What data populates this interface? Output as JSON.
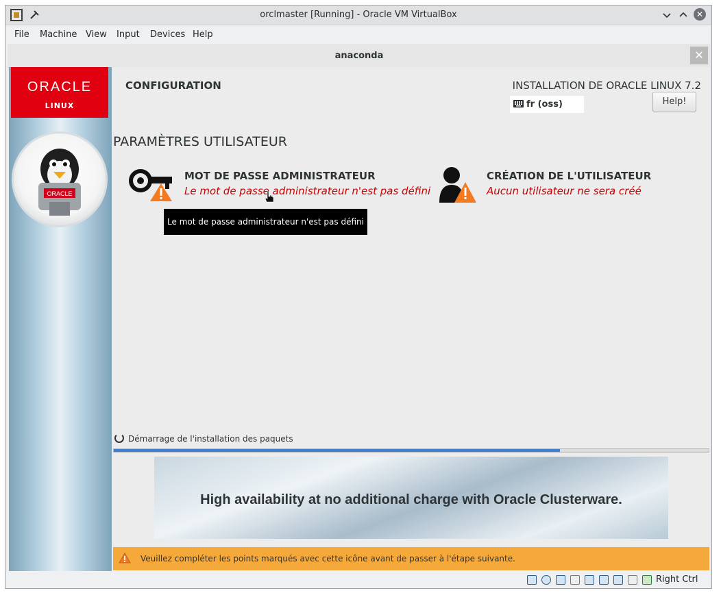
{
  "window": {
    "title": "orclmaster [Running] - Oracle VM VirtualBox"
  },
  "menu": [
    "File",
    "Machine",
    "View",
    "Input",
    "Devices",
    "Help"
  ],
  "anaconda": {
    "title": "anaconda",
    "close_label": "✕"
  },
  "sidebar": {
    "logo_line1": "ORACLE",
    "logo_line2": "LINUX",
    "mascot_badge": "ORACLE"
  },
  "header": {
    "section": "CONFIGURATION",
    "product": "INSTALLATION DE ORACLE LINUX 7.2",
    "keyboard_layout": "fr (oss)",
    "help_label": "Help!"
  },
  "users": {
    "heading": "PARAMÈTRES UTILISATEUR",
    "root": {
      "title": "MOT DE PASSE ADMINISTRATEUR",
      "status": "Le mot de passe administrateur n'est pas défini",
      "icon": "key-warning-icon"
    },
    "user": {
      "title": "CRÉATION DE L'UTILISATEUR",
      "status": "Aucun utilisateur ne sera créé",
      "icon": "user-warning-icon"
    }
  },
  "tooltip": "Le mot de passe administrateur n'est pas défini",
  "progress": {
    "label": "Démarrage de l'installation des paquets",
    "fraction": 0.75
  },
  "banner": {
    "text": "High availability at no additional charge with Oracle Clusterware."
  },
  "warning": {
    "text": "Veuillez compléter les points marqués avec cette icône avant de passer à l'étape suivante."
  },
  "statusbar": {
    "host_key": "Right Ctrl"
  },
  "colors": {
    "accent": "#3e7fd2",
    "warning_bar": "#f6a93b",
    "error_text": "#cc0000",
    "oracle_red": "#e00010"
  }
}
